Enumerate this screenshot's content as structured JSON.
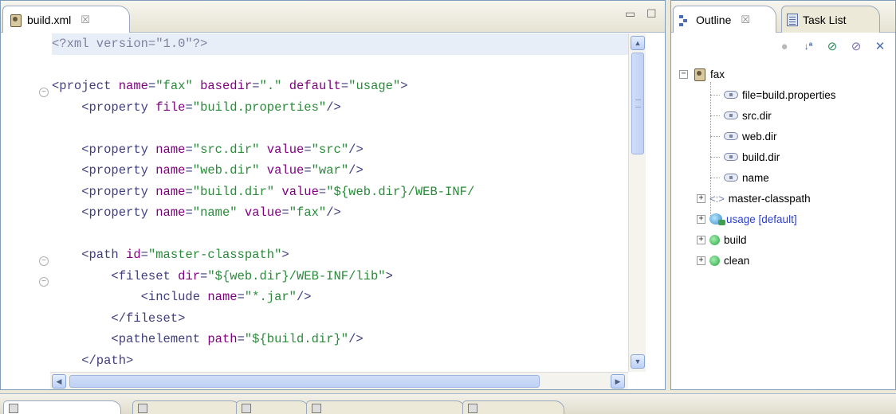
{
  "editor": {
    "tab_label": "build.xml",
    "tab_close": "☒",
    "minimize": "▭",
    "maximize": "☐",
    "code_lines": [
      [
        [
          "pi",
          "<?xml version=\"1.0\"?>"
        ]
      ],
      [],
      [
        [
          "tag",
          "<project "
        ],
        [
          "attr",
          "name"
        ],
        [
          "tag",
          "="
        ],
        [
          "val",
          "\"fax\""
        ],
        [
          "tag",
          " "
        ],
        [
          "attr",
          "basedir"
        ],
        [
          "tag",
          "="
        ],
        [
          "val",
          "\".\""
        ],
        [
          "tag",
          " "
        ],
        [
          "attr",
          "default"
        ],
        [
          "tag",
          "="
        ],
        [
          "val",
          "\"usage\""
        ],
        [
          "tag",
          ">"
        ]
      ],
      [
        [
          "tag",
          "    <property "
        ],
        [
          "attr",
          "file"
        ],
        [
          "tag",
          "="
        ],
        [
          "val",
          "\"build.properties\""
        ],
        [
          "tag",
          "/>"
        ]
      ],
      [],
      [
        [
          "tag",
          "    <property "
        ],
        [
          "attr",
          "name"
        ],
        [
          "tag",
          "="
        ],
        [
          "val",
          "\"src.dir\""
        ],
        [
          "tag",
          " "
        ],
        [
          "attr",
          "value"
        ],
        [
          "tag",
          "="
        ],
        [
          "val",
          "\"src\""
        ],
        [
          "tag",
          "/>"
        ]
      ],
      [
        [
          "tag",
          "    <property "
        ],
        [
          "attr",
          "name"
        ],
        [
          "tag",
          "="
        ],
        [
          "val",
          "\"web.dir\""
        ],
        [
          "tag",
          " "
        ],
        [
          "attr",
          "value"
        ],
        [
          "tag",
          "="
        ],
        [
          "val",
          "\"war\""
        ],
        [
          "tag",
          "/>"
        ]
      ],
      [
        [
          "tag",
          "    <property "
        ],
        [
          "attr",
          "name"
        ],
        [
          "tag",
          "="
        ],
        [
          "val",
          "\"build.dir\""
        ],
        [
          "tag",
          " "
        ],
        [
          "attr",
          "value"
        ],
        [
          "tag",
          "="
        ],
        [
          "val",
          "\"${web.dir}/WEB-INF/"
        ]
      ],
      [
        [
          "tag",
          "    <property "
        ],
        [
          "attr",
          "name"
        ],
        [
          "tag",
          "="
        ],
        [
          "val",
          "\"name\""
        ],
        [
          "tag",
          " "
        ],
        [
          "attr",
          "value"
        ],
        [
          "tag",
          "="
        ],
        [
          "val",
          "\"fax\""
        ],
        [
          "tag",
          "/>"
        ]
      ],
      [],
      [
        [
          "tag",
          "    <path "
        ],
        [
          "attr",
          "id"
        ],
        [
          "tag",
          "="
        ],
        [
          "val",
          "\"master-classpath\""
        ],
        [
          "tag",
          ">"
        ]
      ],
      [
        [
          "tag",
          "        <fileset "
        ],
        [
          "attr",
          "dir"
        ],
        [
          "tag",
          "="
        ],
        [
          "val",
          "\"${web.dir}/WEB-INF/lib\""
        ],
        [
          "tag",
          ">"
        ]
      ],
      [
        [
          "tag",
          "            <include "
        ],
        [
          "attr",
          "name"
        ],
        [
          "tag",
          "="
        ],
        [
          "val",
          "\"*.jar\""
        ],
        [
          "tag",
          "/>"
        ]
      ],
      [
        [
          "tag",
          "        </fileset>"
        ]
      ],
      [
        [
          "tag",
          "        <pathelement "
        ],
        [
          "attr",
          "path"
        ],
        [
          "tag",
          "="
        ],
        [
          "val",
          "\"${build.dir}\""
        ],
        [
          "tag",
          "/>"
        ]
      ],
      [
        [
          "tag",
          "    </path>"
        ]
      ]
    ],
    "scroll_up": "▲",
    "scroll_down": "▼",
    "scroll_left": "◀",
    "scroll_right": "▶"
  },
  "outline": {
    "tab_outline": "Outline",
    "tab_close": "☒",
    "tab_tasklist": "Task List",
    "toolbar_icons": [
      "hide-fields-icon",
      "sort-az-icon",
      "filter-icon",
      "hide-nonpublic-icon",
      "hide-static-icon"
    ],
    "tree": {
      "root": "fax",
      "children": [
        {
          "label": "file=build.properties",
          "type": "property"
        },
        {
          "label": "src.dir",
          "type": "property"
        },
        {
          "label": "web.dir",
          "type": "property"
        },
        {
          "label": "build.dir",
          "type": "property"
        },
        {
          "label": "name",
          "type": "property"
        },
        {
          "label": "master-classpath",
          "type": "path"
        },
        {
          "label": "usage [default]",
          "type": "target-default"
        },
        {
          "label": "build",
          "type": "target"
        },
        {
          "label": "clean",
          "type": "target"
        }
      ]
    }
  },
  "colors": {
    "tag": "#3f3f7f",
    "attribute": "#7f007f",
    "value": "#2a8a3a",
    "default_target": "#2a3fd1"
  }
}
